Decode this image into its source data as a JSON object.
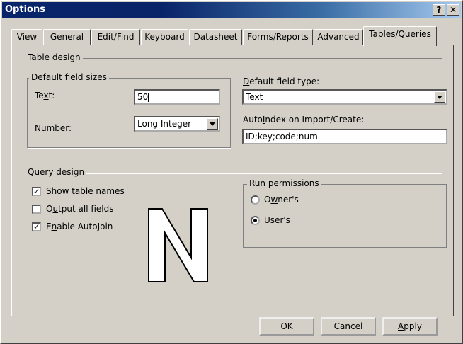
{
  "title_bar": {
    "title": "Options",
    "help": "?",
    "close": "✕"
  },
  "tabs": [
    {
      "label": "View"
    },
    {
      "label": "General"
    },
    {
      "label": "Edit/Find"
    },
    {
      "label": "Keyboard"
    },
    {
      "label": "Datasheet"
    },
    {
      "label": "Forms/Reports"
    },
    {
      "label": "Advanced"
    },
    {
      "label": "Tables/Queries"
    }
  ],
  "table_design": {
    "title": "Table design",
    "default_field_sizes": {
      "title": "Default field sizes",
      "text_label": "Text:",
      "text_value": "50",
      "number_label": "Number:",
      "number_value": "Long Integer"
    },
    "default_field_type_label": "Default field type:",
    "default_field_type_value": "Text",
    "autoindex_label": "AutoIndex on Import/Create:",
    "autoindex_value": "ID;key;code;num"
  },
  "query_design": {
    "title": "Query design",
    "show_table_names": {
      "label": "Show table names",
      "checked": true
    },
    "output_all_fields": {
      "label": "Output all fields",
      "checked": false
    },
    "enable_autojoin": {
      "label": "Enable AutoJoin",
      "checked": true
    },
    "run_permissions": {
      "title": "Run permissions",
      "owners": {
        "label": "Owner's",
        "selected": false
      },
      "users": {
        "label": "User's",
        "selected": true
      }
    }
  },
  "watermark_letter": "N",
  "buttons": {
    "ok": "OK",
    "cancel": "Cancel",
    "apply": "Apply"
  }
}
